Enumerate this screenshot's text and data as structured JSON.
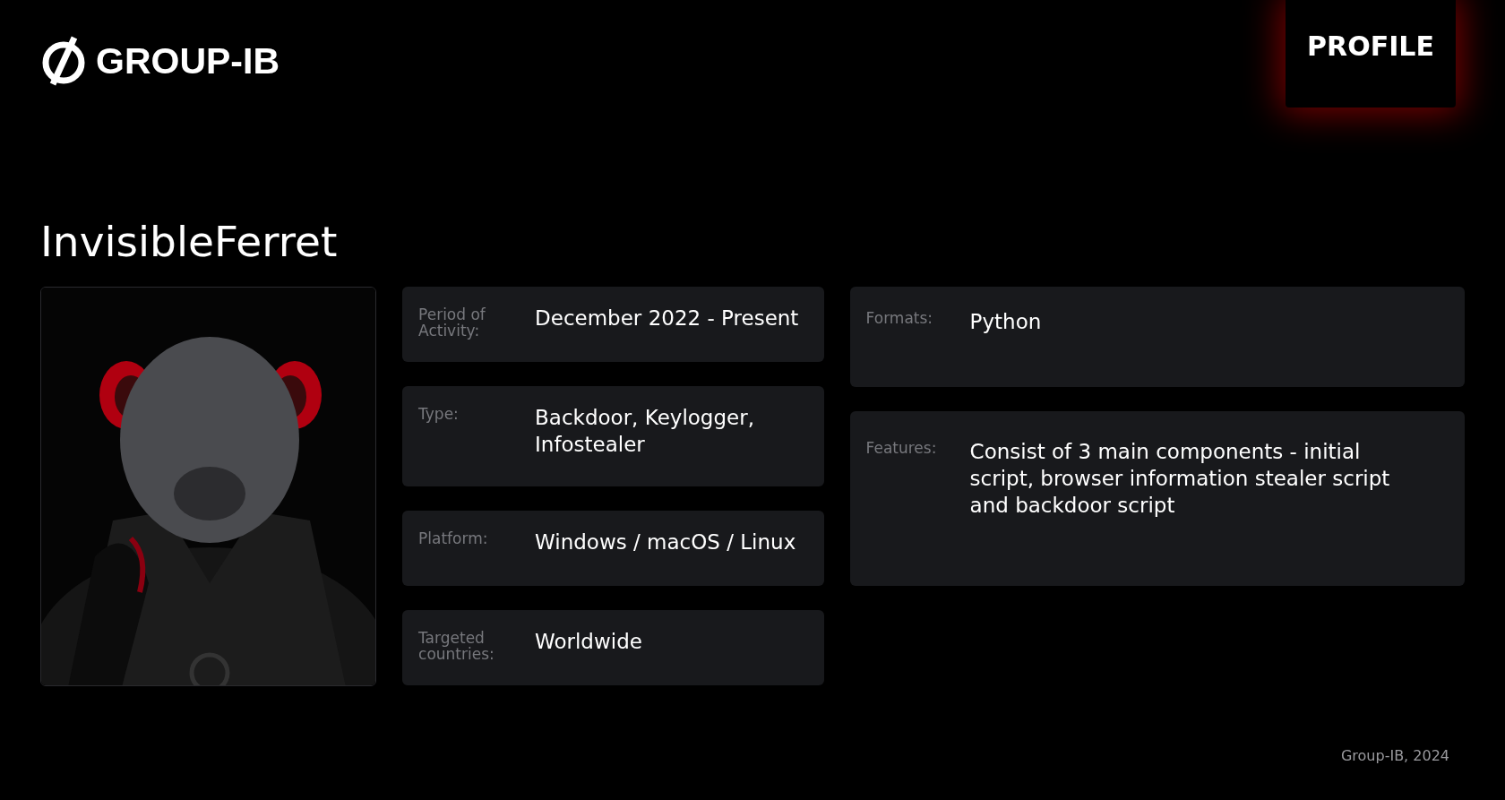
{
  "brand": {
    "name": "GROUP-IB"
  },
  "ribbon": {
    "label": "PROFILE"
  },
  "title": "InvisibleFerret",
  "left_cards": [
    {
      "label": "Period of Activity:",
      "value": "December 2022 - Present"
    },
    {
      "label": "Type:",
      "value": "Backdoor, Keylogger, Infostealer"
    },
    {
      "label": "Platform:",
      "value": "Windows / macOS / Linux"
    },
    {
      "label": "Targeted countries:",
      "value": "Worldwide"
    }
  ],
  "right_cards": [
    {
      "label": "Formats:",
      "value": "Python"
    },
    {
      "label": "Features:",
      "value": "Consist of 3 main components - initial script, browser information stealer script and backdoor script"
    }
  ],
  "footer": "Group-IB, 2024"
}
